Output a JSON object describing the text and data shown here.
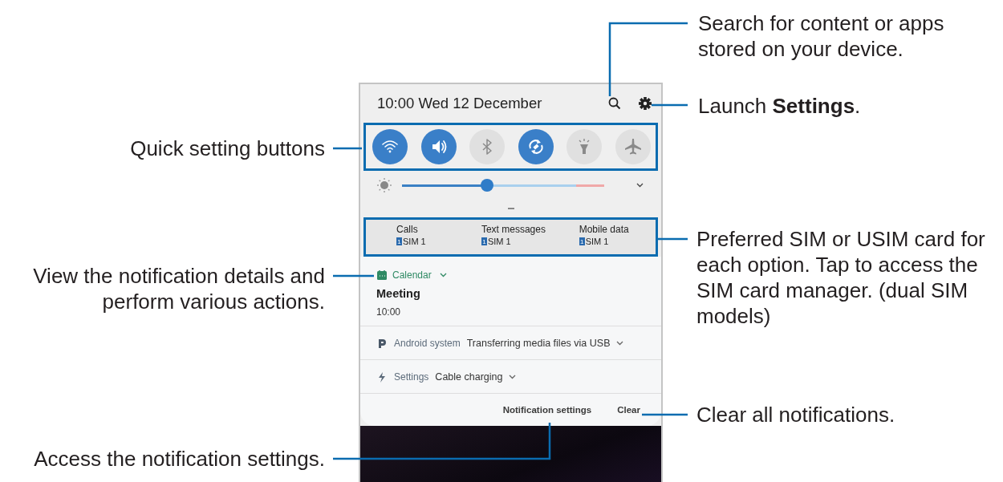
{
  "right_callouts": [
    "Search for content or apps stored on your device.",
    "Launch **Settings**.",
    "Preferred SIM or USIM card for each option. Tap to access the SIM card manager. (dual SIM models)",
    "Clear all notifications."
  ],
  "left_callouts": [
    "Quick setting buttons",
    "View the notification details and perform various actions.",
    "Access the notification settings."
  ],
  "phone": {
    "header": {
      "time_date": "10:00  Wed 12 December"
    },
    "quick_settings": [
      {
        "on": true
      },
      {
        "on": true
      },
      {
        "on": false
      },
      {
        "on": true
      },
      {
        "on": false
      },
      {
        "on": false
      }
    ],
    "brightness": {
      "level": 0.42
    },
    "sim_panel": [
      {
        "label": "Calls",
        "sim_badge": "1",
        "sim": "SIM 1"
      },
      {
        "label": "Text messages",
        "sim_badge": "1",
        "sim": "SIM 1"
      },
      {
        "label": "Mobile data",
        "sim_badge": "1",
        "sim": "SIM 1"
      }
    ],
    "notifications": [
      {
        "kind": "expanded",
        "app": "Calendar",
        "title": "Meeting",
        "text": "10:00"
      },
      {
        "kind": "compact",
        "app": "Android system",
        "text": "Transferring media files via USB"
      },
      {
        "kind": "compact",
        "app": "Settings",
        "text": "Cable charging"
      }
    ],
    "footer_buttons": [
      "Notification settings",
      "Clear"
    ]
  }
}
